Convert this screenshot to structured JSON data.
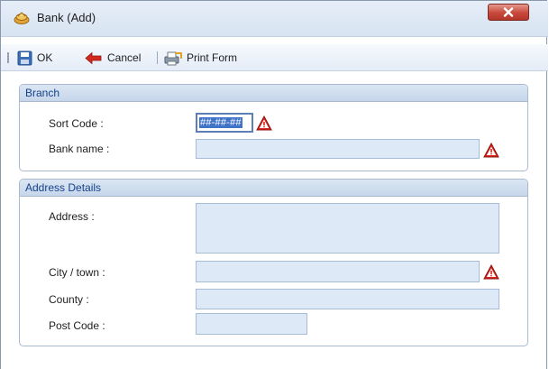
{
  "window": {
    "title": "Bank (Add)"
  },
  "toolbar": {
    "ok_label": "OK",
    "cancel_label": "Cancel",
    "print_label": "Print Form"
  },
  "branch": {
    "title": "Branch",
    "sort_code_label": "Sort Code :",
    "sort_code_value": "##-##-##",
    "bank_name_label": "Bank name :",
    "bank_name_value": ""
  },
  "address": {
    "title": "Address Details",
    "address_label": "Address :",
    "city_label": "City / town :",
    "county_label": "County :",
    "post_code_label": "Post Code :"
  },
  "colors": {
    "warning": "#d9251c",
    "group_title": "#15428b",
    "field_bg": "#dde9f7"
  }
}
